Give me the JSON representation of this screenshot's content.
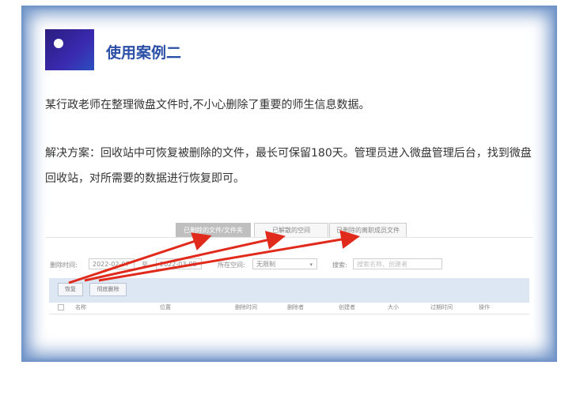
{
  "title": "使用案例二",
  "paragraphs": [
    "某行政老师在整理微盘文件时,不小心删除了重要的师生信息数据。",
    "解决方案：回收站中可恢复被删除的文件，最长可保留180天。管理员进入微盘管理后台，找到微盘回收站，对所需要的数据进行恢复即可。"
  ],
  "recycle_bin": {
    "tabs": [
      "已删除的文件/文件夹",
      "已解散的空间",
      "已删除的离职成员文件"
    ],
    "filters": {
      "deleted_time_label": "删除时间:",
      "date_from": "2022-02-07",
      "date_sep": "至",
      "date_to": "2022-03-08",
      "space_label": "所在空间:",
      "space_value": "无限制",
      "search_label": "搜索:",
      "search_placeholder": "搜索名称、创建者"
    },
    "buttons": {
      "restore": "恢复",
      "delete_forever": "彻底删除"
    },
    "columns": [
      "名称",
      "位置",
      "删除时间",
      "删除者",
      "创建者",
      "大小",
      "过期时间",
      "操作"
    ],
    "arrow_color": "#e02a1c"
  }
}
